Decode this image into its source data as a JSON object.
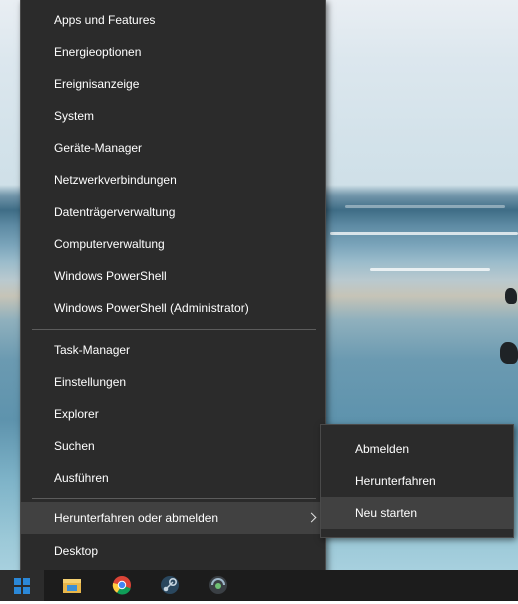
{
  "menu": {
    "items_group1": [
      "Apps und Features",
      "Energieoptionen",
      "Ereignisanzeige",
      "System",
      "Geräte-Manager",
      "Netzwerkverbindungen",
      "Datenträgerverwaltung",
      "Computerverwaltung",
      "Windows PowerShell",
      "Windows PowerShell (Administrator)"
    ],
    "items_group2": [
      "Task-Manager",
      "Einstellungen",
      "Explorer",
      "Suchen",
      "Ausführen"
    ],
    "shutdown_label": "Herunterfahren oder abmelden",
    "desktop_label": "Desktop"
  },
  "submenu": {
    "items": [
      "Abmelden",
      "Herunterfahren",
      "Neu starten"
    ],
    "highlighted": "Neu starten"
  },
  "taskbar": {
    "icons": [
      "windows-start-icon",
      "file-explorer-icon",
      "chrome-icon",
      "steam-icon",
      "media-app-icon"
    ]
  },
  "colors": {
    "menu_bg": "#2b2b2b",
    "hover_bg": "#414141",
    "accent": "#2b88d8"
  }
}
